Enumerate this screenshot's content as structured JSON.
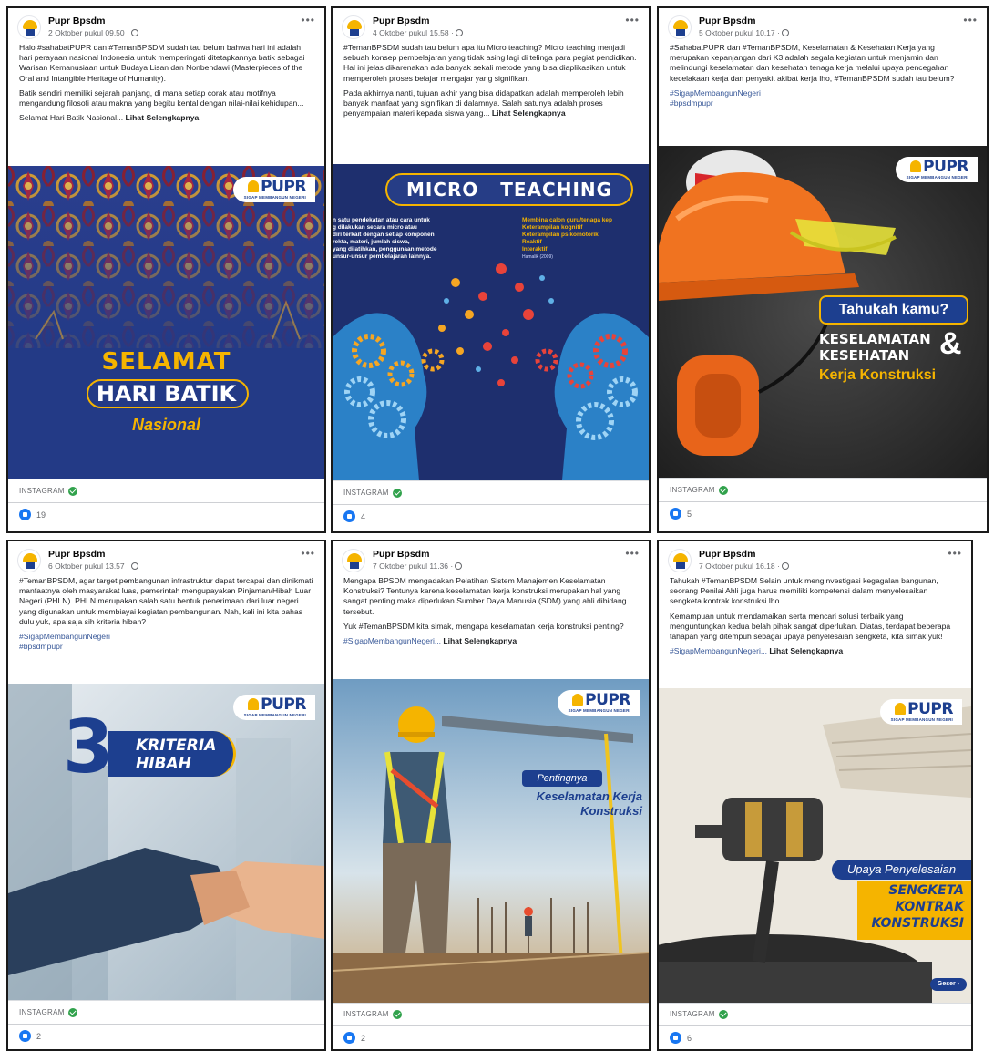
{
  "page_name": "Pupr Bpsdm",
  "source_label": "INSTAGRAM",
  "logo": {
    "word": "PUPR",
    "tagline": "SIGAP MEMBANGUN NEGERI"
  },
  "more_icon": "•••",
  "colors": {
    "navy": "#1d3f8f",
    "yellow": "#f5b400",
    "link": "#385898",
    "like": "#1877f2"
  },
  "posts": [
    {
      "date": "2 Oktober pukul 09.50 ·",
      "paragraphs": [
        "Halo #sahabatPUPR dan #TemanBPSDM sudah tau belum bahwa hari ini adalah hari perayaan nasional Indonesia untuk memperingati ditetapkannya batik sebagai Warisan Kemanusiaan untuk Budaya Lisan dan Nonbendawi (Masterpieces of the Oral and Intangible Heritage of Humanity).",
        "Batik sendiri memiliki sejarah panjang, di mana setiap corak atau motifnya mengandung filosofi atau makna yang begitu kental dengan nilai-nilai kehidupan...",
        "Selamat Hari Batik Nasional..."
      ],
      "see_more": "Lihat Selengkapnya",
      "image_text": {
        "line1": "SELAMAT",
        "line2": "HARI BATIK",
        "line3": "Nasional"
      },
      "reactions": "19"
    },
    {
      "date": "4 Oktober pukul 15.58 ·",
      "paragraphs": [
        "#TemanBPSDM sudah tau belum apa itu Micro teaching? Micro teaching menjadi sebuah konsep pembelajaran yang tidak asing lagi di telinga para pegiat pendidikan. Hal ini jelas dikarenakan ada banyak sekali metode yang bisa diaplikasikan untuk memperoleh proses belajar mengajar yang signifikan.",
        "Pada akhirnya nanti, tujuan akhir yang bisa didapatkan adalah memperoleh lebih banyak manfaat yang signifikan di dalamnya. Salah satunya adalah proses penyampaian materi kepada siswa yang..."
      ],
      "see_more": "Lihat Selengkapnya",
      "image_text": {
        "title": "MICRO   TEACHING",
        "left": "n satu pendekatan atau cara untuk\ng dilakukan secara micro atau\ndiri terkait dengan setiap komponen\nrekta, materi, jumlah siswa,\nyang dilatihkan, penggunaan metode\nunsur-unsur pembelajaran lainnya.",
        "right": [
          "Membina calon guru/tenaga kep",
          "Keterampilan kognitif",
          "Keterampilan psikomotorik",
          "Reaktif",
          "Interaktif"
        ],
        "cite": "Hamalik (2009)"
      },
      "reactions": "4"
    },
    {
      "date": "5 Oktober pukul 10.17 ·",
      "paragraphs": [
        "#SahabatPUPR dan #TemanBPSDM, Keselamatan & Kesehatan Kerja yang merupakan kepanjangan dari K3 adalah segala kegiatan untuk menjamin dan melindungi keselamatan dan kesehatan tenaga kerja melalui upaya pencegahan kecelakaan kerja dan penyakit akibat kerja lho, #TemanBPSDM sudah tau belum?"
      ],
      "tags": [
        "#SigapMembangunNegeri",
        "#bpsdmpupr"
      ],
      "image_text": {
        "pill": "Tahukah kamu?",
        "l1": "KESELAMATAN",
        "l2": "KESEHATAN",
        "amp": "&",
        "l3": "Kerja Konstruksi"
      },
      "reactions": "5"
    },
    {
      "date": "6 Oktober pukul 13.57 ·",
      "paragraphs": [
        "#TemanBPSDM, agar target pembangunan infrastruktur dapat tercapai dan dinikmati manfaatnya oleh masyarakat luas, pemerintah mengupayakan Pinjaman/Hibah Luar Negeri (PHLN). PHLN merupakan salah satu bentuk penerimaan dari luar negeri yang digunakan untuk membiayai kegiatan pembangunan. Nah, kali ini kita bahas dulu yuk, apa saja sih kriteria hibah?"
      ],
      "tags": [
        "#SigapMembangunNegeri",
        "#bpsdmpupr"
      ],
      "image_text": {
        "num": "3",
        "l1": "KRITERIA",
        "l2": "HIBAH"
      },
      "reactions": "2"
    },
    {
      "date": "7 Oktober pukul 11.36 ·",
      "paragraphs": [
        "Mengapa BPSDM mengadakan Pelatihan Sistem Manajemen Keselamatan Konstruksi? Tentunya karena keselamatan kerja konstruksi merupakan hal yang sangat penting maka diperlukan Sumber Daya Manusia (SDM) yang ahli dibidang tersebut.",
        "Yuk #TemanBPSDM kita simak, mengapa keselamatan kerja konstruksi penting?"
      ],
      "tag_line": "#SigapMembangunNegeri...",
      "see_more": "Lihat Selengkapnya",
      "image_text": {
        "pill": "Pentingnya",
        "l1": "Keselamatan Kerja",
        "l2": "Konstruksi"
      },
      "reactions": "2"
    },
    {
      "date": "7 Oktober pukul 16.18 ·",
      "paragraphs": [
        "Tahukah #TemanBPSDM Selain untuk menginvestigasi kegagalan bangunan, seorang Penilai Ahli juga harus memiliki kompetensi dalam menyelesaikan sengketa kontrak konstruksi lho.",
        "Kemampuan untuk mendamaikan serta mencari solusi terbaik yang menguntungkan kedua belah pihak sangat diperlukan. Diatas, terdapat beberapa tahapan yang ditempuh sebagai upaya penyelesaian sengketa, kita simak yuk!"
      ],
      "tag_line": "#SigapMembangunNegeri...",
      "see_more": "Lihat Selengkapnya",
      "image_text": {
        "pill": "Upaya Penyelesaian",
        "l1": "SENGKETA",
        "l2": "KONTRAK",
        "l3": "KONSTRUKSI",
        "swipe": "Geser"
      },
      "reactions": "6"
    }
  ]
}
